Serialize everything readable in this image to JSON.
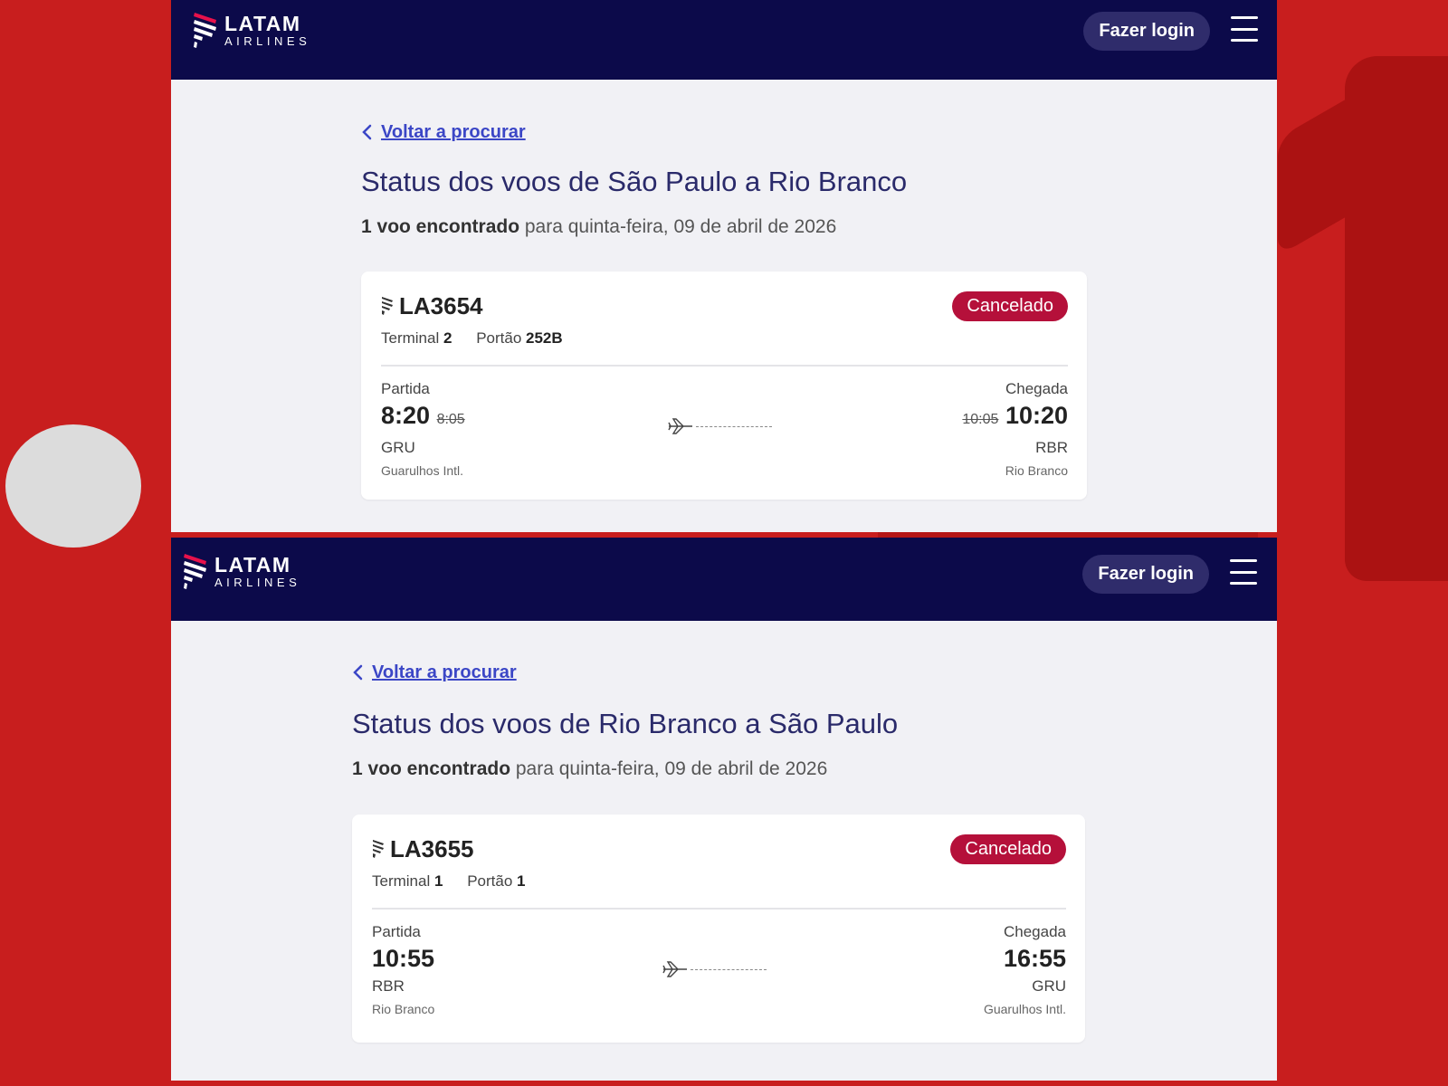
{
  "screens": [
    {
      "header": {
        "logo_main": "LATAM",
        "logo_sub": "AIRLINES",
        "login_label": "Fazer login"
      },
      "back_link": "Voltar a procurar",
      "title": "Status dos voos de São Paulo a Rio Branco",
      "count_bold": "1 voo encontrado",
      "count_rest": " para quinta-feira, 09 de abril de 2026",
      "flight": {
        "number": "LA3654",
        "status": "Cancelado",
        "terminal_label": "Terminal",
        "terminal": "2",
        "gate_label": "Portão",
        "gate": "252B",
        "departure": {
          "label": "Partida",
          "time": "8:20",
          "old_time": "8:05",
          "code": "GRU",
          "airport": "Guarulhos Intl."
        },
        "arrival": {
          "label": "Chegada",
          "time": "10:20",
          "old_time": "10:05",
          "code": "RBR",
          "airport": "Rio Branco"
        }
      }
    },
    {
      "header": {
        "logo_main": "LATAM",
        "logo_sub": "AIRLINES",
        "login_label": "Fazer login"
      },
      "back_link": "Voltar a procurar",
      "title": "Status dos voos de Rio Branco a São Paulo",
      "count_bold": "1 voo encontrado",
      "count_rest": " para quinta-feira, 09 de abril de 2026",
      "flight": {
        "number": "LA3655",
        "status": "Cancelado",
        "terminal_label": "Terminal",
        "terminal": "1",
        "gate_label": "Portão",
        "gate": "1",
        "departure": {
          "label": "Partida",
          "time": "10:55",
          "code": "RBR",
          "airport": "Rio Branco"
        },
        "arrival": {
          "label": "Chegada",
          "time": "16:55",
          "code": "GRU",
          "airport": "Guarulhos Intl."
        }
      }
    }
  ],
  "colors": {
    "page_background": "#c81e1e",
    "nav_background": "#0c0a4a",
    "status_cancelled": "#b5103a",
    "link": "#3b46c6"
  },
  "icons": [
    "latam-logo-icon",
    "menu-icon",
    "chevron-left-icon",
    "latam-small-logo-icon",
    "airplane-icon"
  ]
}
